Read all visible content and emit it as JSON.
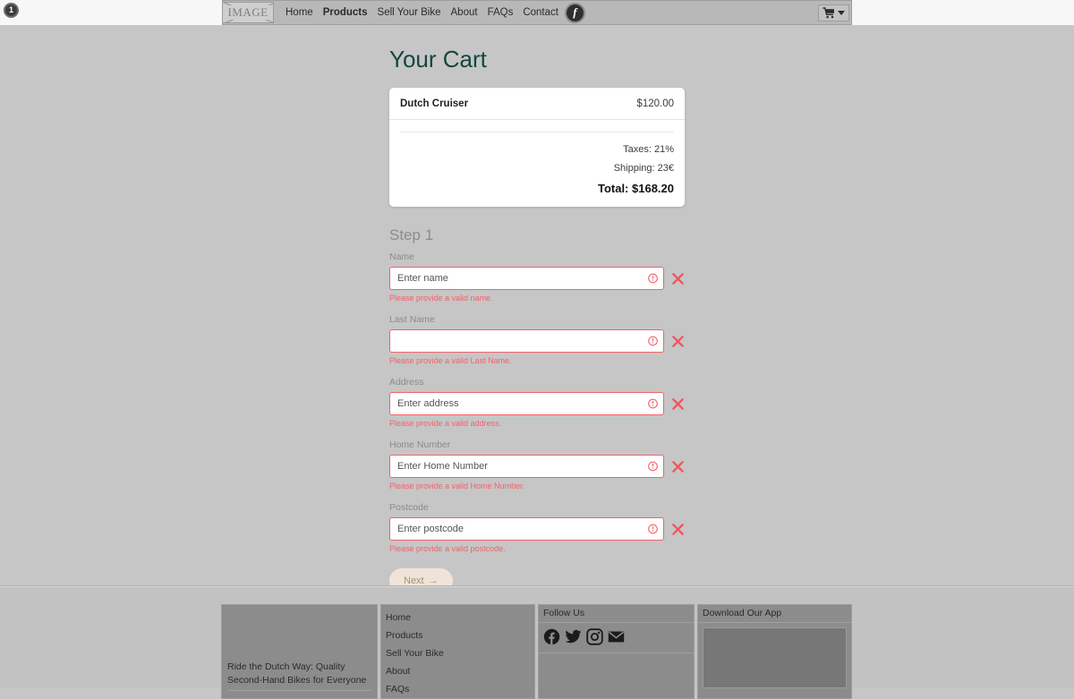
{
  "window": {
    "corner_badge": "1"
  },
  "navbar": {
    "logo_alt": "IMAGE",
    "items": [
      {
        "label": "Home",
        "active": false
      },
      {
        "label": "Products",
        "active": true
      },
      {
        "label": "Sell Your Bike",
        "active": false
      },
      {
        "label": "About",
        "active": false
      },
      {
        "label": "FAQs",
        "active": false
      },
      {
        "label": "Contact",
        "active": false
      }
    ],
    "info_glyph": "f",
    "cart_icon": "shopping-cart-icon"
  },
  "main": {
    "page_title": "Your Cart",
    "cart": {
      "item_name": "Dutch Cruiser",
      "item_price": "$120.00",
      "taxes": "Taxes: 21%",
      "shipping": "Shipping: 23€",
      "total": "Total: $168.20"
    },
    "step_title": "Step 1",
    "fields": [
      {
        "label": "Name",
        "placeholder": "Enter name",
        "value": "",
        "error": "Please provide a valid name."
      },
      {
        "label": "Last Name",
        "placeholder": "",
        "value": "",
        "error": "Please provide a valid Last Name."
      },
      {
        "label": "Address",
        "placeholder": "Enter address",
        "value": "",
        "error": "Please provide a valid address."
      },
      {
        "label": "Home Number",
        "placeholder": "Enter Home Number",
        "value": "",
        "error": "Please provide a valid Home Number."
      },
      {
        "label": "Postcode",
        "placeholder": "Enter postcode",
        "value": "",
        "error": "Please provide a valid postcode."
      }
    ],
    "next_button": "Next",
    "next_button_arrow": "→"
  },
  "footer": {
    "about_text": "Ride the Dutch Way: Quality Second-Hand Bikes for Everyone",
    "links": [
      "Home",
      "Products",
      "Sell Your Bike",
      "About",
      "FAQs"
    ],
    "social_heading": "Follow Us",
    "social_icons": [
      "facebook-icon",
      "twitter-icon",
      "instagram-icon",
      "email-icon"
    ],
    "app_heading": "Download Our App"
  },
  "colors": {
    "accent_title": "#14473f",
    "error": "#f2626b",
    "page_bg": "#c6c6c6",
    "next_bg": "#f0e4d9"
  }
}
